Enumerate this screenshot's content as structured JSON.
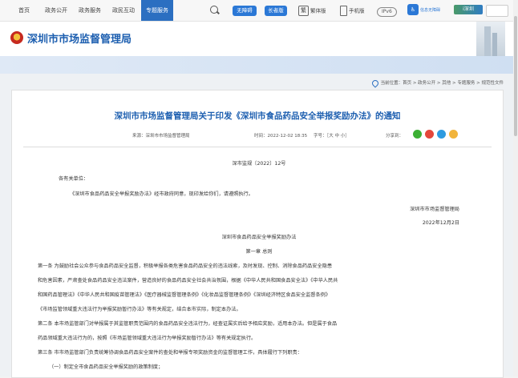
{
  "topnav": {
    "items": [
      "首页",
      "政务公开",
      "政务服务",
      "政民互动",
      "专题服务"
    ],
    "active_index": 4,
    "no_barrier": "无障碍",
    "elder_mode": "长者版",
    "traditional": "繁体版",
    "mobile": "手机版",
    "ipv6": "IPv6",
    "access_label": "信息无障碍",
    "logo_text": "i深圳"
  },
  "header": {
    "site_title": "深圳市市场监督管理局"
  },
  "breadcrumb": {
    "text": "当前位置：首页 > 政务公开 > 其他 > 专题服务 > 规范性文件"
  },
  "article": {
    "title": "深圳市市场监督管理局关于印发《深圳市食品药品安全举报奖励办法》的通知",
    "source": "来源：深圳市市场监督管理局",
    "time": "时间：2022-12-02 18:35",
    "font_size": "字号：［大  中  小］",
    "share": "分享到：",
    "doc_no": "深市监规〔2022〕12号",
    "salutation": "各有关单位：",
    "intro": "《深圳市食品药品安全举报奖励办法》经市政府同意，现印发给你们，请遵照执行。",
    "signature": "深圳市市场监督管理局",
    "date": "2022年12月2日",
    "doc_title": "深圳市食品药品安全举报奖励办法",
    "chapter": "第一章  总则",
    "art1_lines": [
      "第一条 为鼓励社会公众参与食品药品安全监督，积极举报各类危害食品药品安全的违法线索，及时发现、控制、消除食品药品安全隐患",
      "和危害因素，严肃查处食品药品安全违法案件，营造良好的食品药品安全社会共治氛围，根据《中华人民共和国食品安全法》《中华人民共",
      "和国药品管理法》《中华人民共和国疫苗管理法》《医疗器械监督管理条例》《化妆品监督管理条例》《深圳经济特区食品安全监督条例》",
      "《市场监管领域重大违法行为举报奖励暂行办法》等有关规定，结合本市实际，制定本办法。"
    ],
    "art2_lines": [
      "第二条 本市场监管部门对举报属于其监管职责范围内的食品药品安全违法行为，经查证属实后给予相应奖励，适用本办法。但是属于食品",
      "药品领域重大违法行为的，按照《市场监管领域重大违法行为举报奖励暂行办法》等有关规定执行。"
    ],
    "art3_lines": [
      "第三条 市市场监管部门负责统筹协调食品药品安全案件的查处和举报专项奖励资金的监督管理工作，具体履行下列职责：",
      "（一）制定全市食品药品安全举报奖励的政策制度；"
    ]
  }
}
